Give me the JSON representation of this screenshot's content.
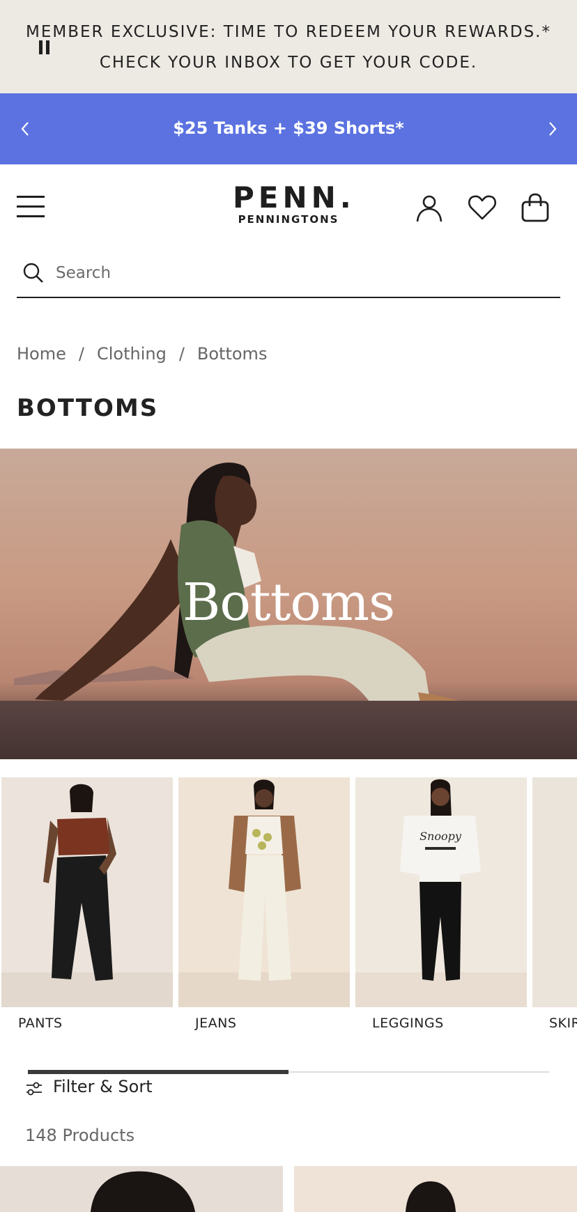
{
  "member_banner": {
    "line1": "MEMBER EXCLUSIVE: TIME TO REDEEM YOUR REWARDS.*",
    "line2": "CHECK YOUR INBOX TO GET YOUR CODE.",
    "pause_icon": "pause-icon"
  },
  "promo": {
    "text": "$25 Tanks + $39 Shorts*",
    "background": "#5b72e0",
    "prev_icon": "chevron-left-icon",
    "next_icon": "chevron-right-icon"
  },
  "header": {
    "logo_main": "PENN.",
    "logo_sub": "PENNINGTONS",
    "icons": [
      "menu-icon",
      "account-icon",
      "heart-icon",
      "bag-icon"
    ]
  },
  "search": {
    "placeholder": "Search"
  },
  "breadcrumb": {
    "items": [
      "Home",
      "Clothing",
      "Bottoms"
    ],
    "separator": "/"
  },
  "page_title": "BOTTOMS",
  "hero": {
    "title": "Bottoms"
  },
  "categories": [
    {
      "label": "PANTS"
    },
    {
      "label": "JEANS"
    },
    {
      "label": "LEGGINGS"
    },
    {
      "label": "SKIR"
    }
  ],
  "filter": {
    "label": "Filter & Sort",
    "icon": "sliders-icon"
  },
  "product_count": "148 Products"
}
